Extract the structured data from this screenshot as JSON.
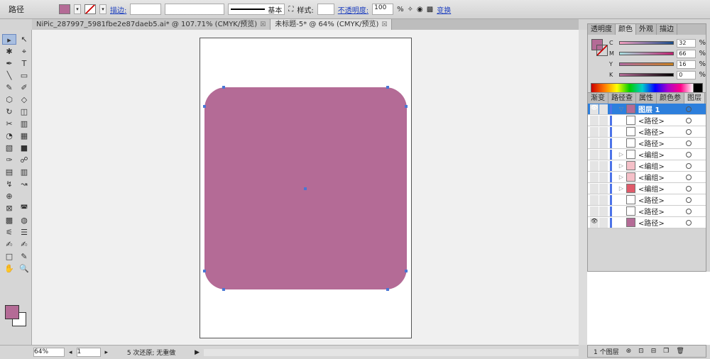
{
  "control_bar": {
    "selection_label": "路径",
    "stroke_label": "描边:",
    "stroke_profile": "基本",
    "style_label": "样式:",
    "opacity_label": "不透明度:",
    "opacity_value": "100",
    "opacity_unit": "%",
    "transform_label": "变换",
    "fill_color": "#b46b96"
  },
  "doc_tabs": [
    {
      "label": "NiPic_287997_5981fbe2e87daeb5.ai* @ 107.71% (CMYK/预览)",
      "active": false
    },
    {
      "label": "未标题-5* @ 64% (CMYK/预览)",
      "active": true
    }
  ],
  "tools": [
    "▸",
    "↖",
    "✱",
    "⌖",
    "✒",
    "T",
    "╲",
    "▭",
    "✎",
    "✐",
    "⬡",
    "◇",
    "↻",
    "◫",
    "✂",
    "▥",
    "◔",
    "▦",
    "▧",
    "■",
    "✑",
    "☍",
    "▤",
    "▥",
    "↯",
    "↝",
    "⊕",
    "",
    "⊠",
    "◚",
    "▩",
    "◍",
    "⚟",
    "☰",
    "✍",
    "✍",
    "□",
    "✎",
    "✋",
    "🔍"
  ],
  "color_panel": {
    "tabs": [
      "透明度",
      "颜色",
      "外观",
      "描边"
    ],
    "active_tab": "颜色",
    "channels": [
      {
        "k": "C",
        "value": "32",
        "grad": "linear-gradient(90deg,#f5a0c0,#1a4d8c)"
      },
      {
        "k": "M",
        "value": "66",
        "grad": "linear-gradient(90deg,#a8e0e0,#c02070)"
      },
      {
        "k": "Y",
        "value": "16",
        "grad": "linear-gradient(90deg,#b06aa0,#c88020)"
      },
      {
        "k": "K",
        "value": "0",
        "grad": "linear-gradient(90deg,#b46b96,#000)"
      }
    ],
    "unit": "%"
  },
  "layers_panel": {
    "tabs": [
      "渐变",
      "路径查",
      "属性",
      "颜色参",
      "图层"
    ],
    "active_tab": "图层",
    "rows": [
      {
        "name": "图层 1",
        "top": true,
        "eye": true,
        "thumb": "#b46b96"
      },
      {
        "name": "<路径>"
      },
      {
        "name": "<路径>"
      },
      {
        "name": "<路径>"
      },
      {
        "name": "<编组>",
        "expand": true
      },
      {
        "name": "<编组>",
        "expand": true,
        "thumb": "#f5c0c8"
      },
      {
        "name": "<编组>",
        "expand": true,
        "thumb": "#f5c0c8"
      },
      {
        "name": "<编组>",
        "expand": true,
        "thumb": "#e05a6a"
      },
      {
        "name": "<路径>"
      },
      {
        "name": "<路径>"
      },
      {
        "name": "<路径>",
        "eye": true,
        "thumb": "#b46b96"
      }
    ],
    "footer": "1 个图层"
  },
  "status": {
    "zoom": "64%",
    "page": "1",
    "history": "5 次还原; 无重做"
  }
}
